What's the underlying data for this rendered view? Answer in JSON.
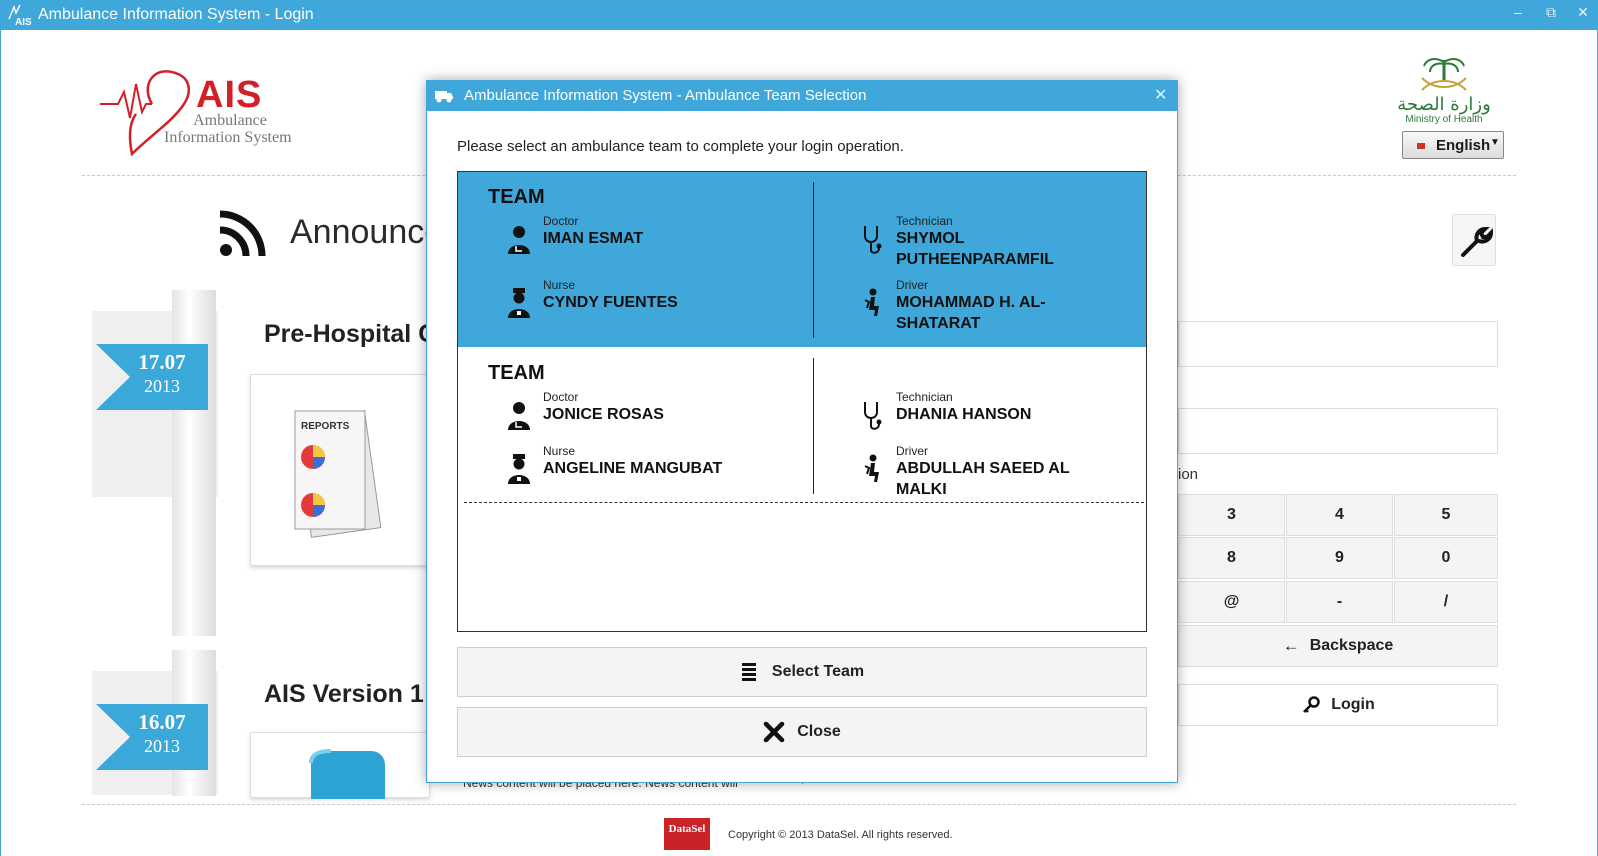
{
  "window": {
    "title": "Ambulance Information System - Login",
    "minimize": "‒",
    "restore": "⧉",
    "close": "✕"
  },
  "logo": {
    "brand": "AIS",
    "line1": "Ambulance",
    "line2": "Information System"
  },
  "ministry": {
    "arabic": "وزارة الصحة",
    "english": "Ministry of Health"
  },
  "language": {
    "selected": "English"
  },
  "announcements": {
    "title": "Announce",
    "items": [
      {
        "day": "17.07",
        "year": "2013",
        "title": "Pre-Hospital C"
      },
      {
        "day": "16.07",
        "year": "2013",
        "title": "AIS Version 1"
      }
    ],
    "news_text": "News content will be placed here. News content will"
  },
  "login": {
    "partial_label": "ion",
    "keys": [
      [
        "3",
        "4",
        "5"
      ],
      [
        "8",
        "9",
        "0"
      ],
      [
        "@",
        "-",
        "/"
      ]
    ],
    "backspace": "Backspace",
    "login": "Login"
  },
  "footer": {
    "logo_text": "DataSel",
    "copyright": "Copyright © 2013 DataSel. All rights reserved."
  },
  "modal": {
    "title": "Ambulance Information System - Ambulance Team Selection",
    "close": "✕",
    "prompt": "Please select an ambulance team to complete your login operation.",
    "teams": [
      {
        "name": "TEAM",
        "doctor": {
          "role": "Doctor",
          "name": "IMAN  ESMAT"
        },
        "nurse": {
          "role": "Nurse",
          "name": "CYNDY FUENTES"
        },
        "technician": {
          "role": "Technician",
          "name": "SHYMOL PUTHEENPARAMFIL"
        },
        "driver": {
          "role": "Driver",
          "name": "MOHAMMAD H.  AL-SHATARAT"
        }
      },
      {
        "name": "TEAM",
        "doctor": {
          "role": "Doctor",
          "name": "JONICE ROSAS"
        },
        "nurse": {
          "role": "Nurse",
          "name": "ANGELINE MANGUBAT"
        },
        "technician": {
          "role": "Technician",
          "name": "DHANIA HANSON"
        },
        "driver": {
          "role": "Driver",
          "name": "ABDULLAH SAEED  AL MALKI"
        }
      }
    ],
    "select_button": "Select Team",
    "close_button": "Close"
  },
  "colors": {
    "accent": "#3fa7da",
    "brand_red": "#d32027",
    "ribbon": "#3aa8d8"
  },
  "icons": [
    "rss-icon",
    "wrench-icon",
    "doctor-icon",
    "nurse-icon",
    "stethoscope-icon",
    "driver-icon",
    "list-icon",
    "close-x-icon",
    "arrow-left-icon",
    "key-icon"
  ]
}
